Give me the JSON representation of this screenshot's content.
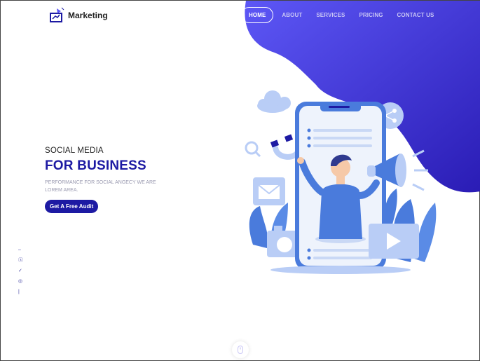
{
  "brand": {
    "name": "Marketing",
    "logo_icon": "megaphone-logo-icon"
  },
  "nav": {
    "items": [
      {
        "label": "HOME",
        "active": true
      },
      {
        "label": "ABOUT",
        "active": false
      },
      {
        "label": "SERVICES",
        "active": false
      },
      {
        "label": "PRICING",
        "active": false
      },
      {
        "label": "CONTACT US",
        "active": false
      }
    ]
  },
  "hero": {
    "subtitle": "SOCIAL MEDIA",
    "title": "FOR BUSINESS",
    "description": "PERFORMANCE FOR SOCIAL ANGECY WE ARE LOREM AREA.",
    "cta_label": "Get A Free Audit"
  },
  "social": {
    "icons": [
      "twitter-icon",
      "skype-icon",
      "vimeo-icon",
      "dribbble-icon",
      "linkedin-icon"
    ]
  },
  "colors": {
    "accent": "#1d1aa3",
    "blob_start": "#5b55f5",
    "blob_end": "#2a1fb8",
    "illustration": "#4a7bdc"
  }
}
